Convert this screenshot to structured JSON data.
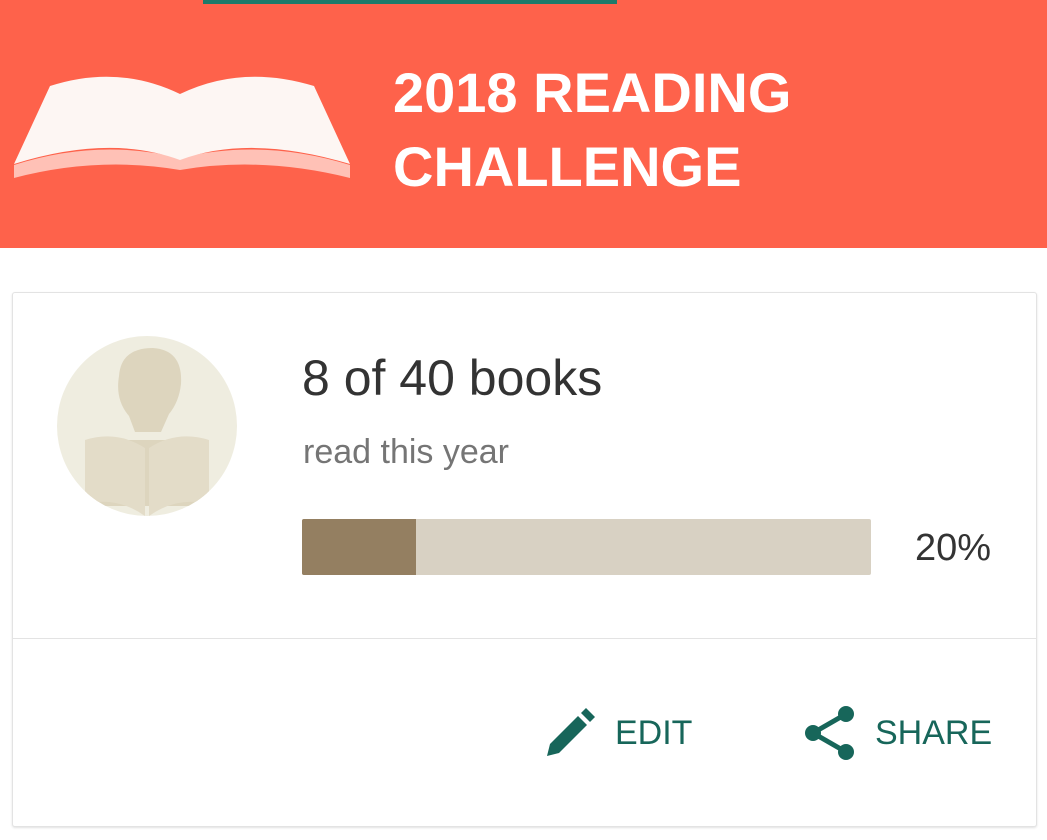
{
  "banner": {
    "title_line1": "2018 READING",
    "title_line2": "CHALLENGE",
    "color": "#fe624b",
    "icon": "open-book-icon"
  },
  "tab_indicator": {
    "color": "#1d7a6a"
  },
  "challenge": {
    "avatar_icon": "reader-silhouette-icon",
    "books_count": "8 of 40 books",
    "books_sub": "read this year",
    "progress_fraction": 0.2,
    "progress_label": "20%",
    "progress_fill_color": "#947f61",
    "progress_track_color": "#d8d1c3"
  },
  "actions": {
    "edit_label": "EDIT",
    "edit_icon": "pencil-icon",
    "share_label": "SHARE",
    "share_icon": "share-icon",
    "color": "#17665a"
  }
}
